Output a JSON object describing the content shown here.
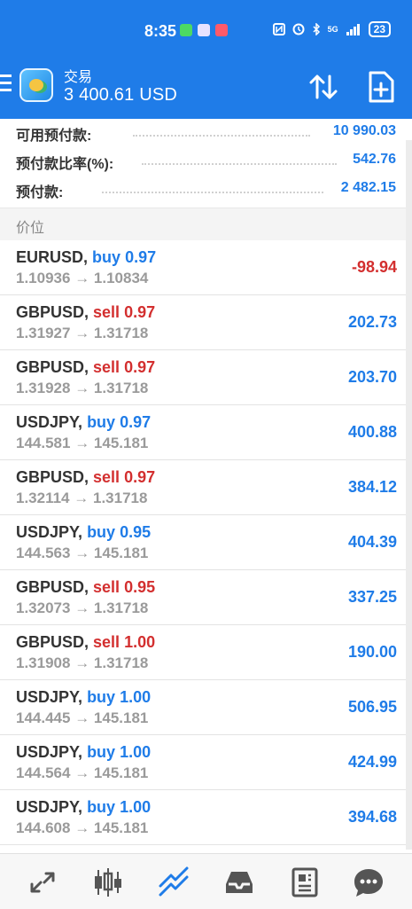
{
  "status_bar": {
    "time": "8:35",
    "network": "5G",
    "battery": "23"
  },
  "header": {
    "title": "交易",
    "balance": "3 400.61 USD"
  },
  "summary": [
    {
      "label": "可用预付款:",
      "value": "10 990.03"
    },
    {
      "label": "预付款比率(%):",
      "value": "542.76"
    },
    {
      "label": "预付款:",
      "value": "2 482.15"
    }
  ],
  "section_title": "价位",
  "positions": [
    {
      "symbol": "EURUSD,",
      "side": "buy",
      "lot": "0.97",
      "open": "1.10936",
      "current": "1.10834",
      "profit": "-98.94"
    },
    {
      "symbol": "GBPUSD,",
      "side": "sell",
      "lot": "0.97",
      "open": "1.31927",
      "current": "1.31718",
      "profit": "202.73"
    },
    {
      "symbol": "GBPUSD,",
      "side": "sell",
      "lot": "0.97",
      "open": "1.31928",
      "current": "1.31718",
      "profit": "203.70"
    },
    {
      "symbol": "USDJPY,",
      "side": "buy",
      "lot": "0.97",
      "open": "144.581",
      "current": "145.181",
      "profit": "400.88"
    },
    {
      "symbol": "GBPUSD,",
      "side": "sell",
      "lot": "0.97",
      "open": "1.32114",
      "current": "1.31718",
      "profit": "384.12"
    },
    {
      "symbol": "USDJPY,",
      "side": "buy",
      "lot": "0.95",
      "open": "144.563",
      "current": "145.181",
      "profit": "404.39"
    },
    {
      "symbol": "GBPUSD,",
      "side": "sell",
      "lot": "0.95",
      "open": "1.32073",
      "current": "1.31718",
      "profit": "337.25"
    },
    {
      "symbol": "GBPUSD,",
      "side": "sell",
      "lot": "1.00",
      "open": "1.31908",
      "current": "1.31718",
      "profit": "190.00"
    },
    {
      "symbol": "USDJPY,",
      "side": "buy",
      "lot": "1.00",
      "open": "144.445",
      "current": "145.181",
      "profit": "506.95"
    },
    {
      "symbol": "USDJPY,",
      "side": "buy",
      "lot": "1.00",
      "open": "144.564",
      "current": "145.181",
      "profit": "424.99"
    },
    {
      "symbol": "USDJPY,",
      "side": "buy",
      "lot": "1.00",
      "open": "144.608",
      "current": "145.181",
      "profit": "394.68"
    }
  ],
  "arrow": "→",
  "colors": {
    "accent": "#1f7ce8",
    "loss": "#d32f2f",
    "muted": "#9a9a9a"
  },
  "bottom_nav": [
    {
      "icon": "quotes-arrows-icon",
      "active": false
    },
    {
      "icon": "candlestick-chart-icon",
      "active": false
    },
    {
      "icon": "trade-trend-icon",
      "active": true
    },
    {
      "icon": "inbox-tray-icon",
      "active": false
    },
    {
      "icon": "news-icon",
      "active": false
    },
    {
      "icon": "chat-bubble-icon",
      "active": false
    }
  ]
}
